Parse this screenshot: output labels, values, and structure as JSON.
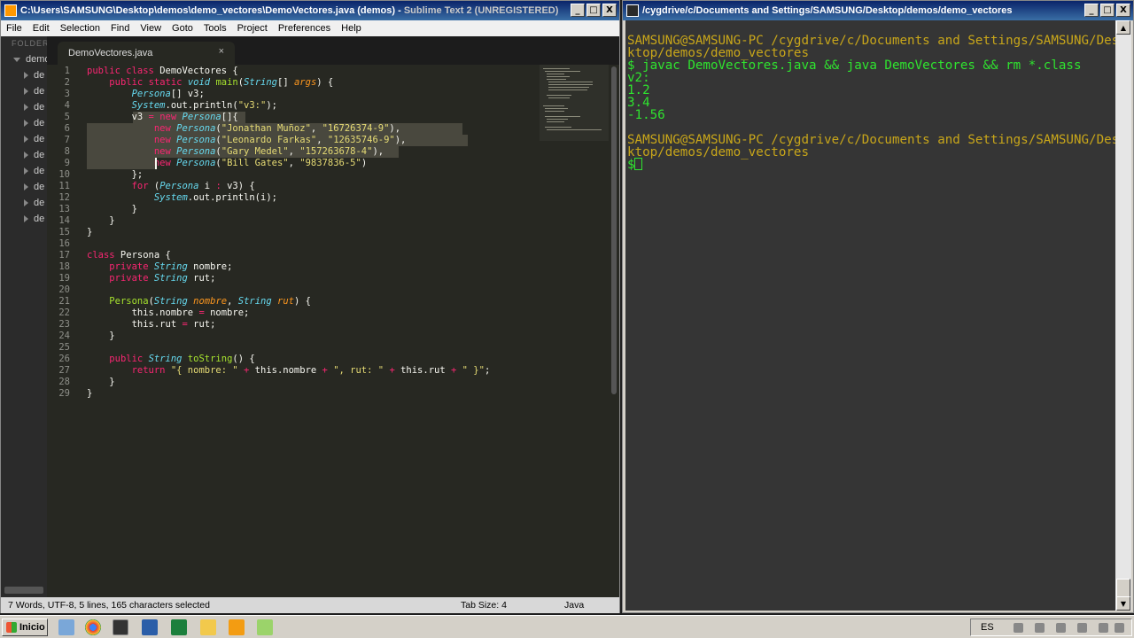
{
  "sublime": {
    "title_main": "C:\\Users\\SAMSUNG\\Desktop\\demos\\demo_vectores\\DemoVectores.java (demos) - ",
    "title_tail": "Sublime Text 2 (UNREGISTERED)",
    "window_buttons": {
      "minimize": "_",
      "maximize": "□",
      "close": "X"
    },
    "menu": [
      "File",
      "Edit",
      "Selection",
      "Find",
      "View",
      "Goto",
      "Tools",
      "Project",
      "Preferences",
      "Help"
    ],
    "sidebar": {
      "folders_label": "FOLDERS",
      "root": "demo",
      "items": [
        "de",
        "de",
        "de",
        "de",
        "de",
        "de",
        "de",
        "de",
        "de",
        "de"
      ]
    },
    "tab": {
      "label": "DemoVectores.java",
      "close": "×"
    },
    "line_numbers": [
      "1",
      "2",
      "3",
      "4",
      "5",
      "6",
      "7",
      "8",
      "9",
      "10",
      "11",
      "12",
      "13",
      "14",
      "15",
      "16",
      "17",
      "18",
      "19",
      "20",
      "21",
      "22",
      "23",
      "24",
      "25",
      "26",
      "27",
      "28",
      "29"
    ],
    "code": {
      "l1": {
        "a": "public",
        "b": " ",
        "c": "class",
        "d": " DemoVectores {"
      },
      "l2": {
        "a": "    ",
        "b": "public",
        "c": " ",
        "d": "static",
        "e": " ",
        "f": "void",
        "g": " ",
        "h": "main",
        "i": "(",
        "j": "String",
        "k": "[] ",
        "l": "args",
        "m": ") {"
      },
      "l3": {
        "a": "        ",
        "b": "Persona",
        "c": "[] v3;"
      },
      "l4": {
        "a": "        ",
        "b": "System",
        "c": ".out.",
        "d": "println",
        "e": "(",
        "f": "\"v3:\"",
        "g": ");"
      },
      "l5": {
        "a": "        v3 ",
        "b": "=",
        "c": " ",
        "d": "new",
        "e": " ",
        "f": "Persona",
        "g": "[]{"
      },
      "l6": {
        "a": "            ",
        "b": "new",
        "c": " ",
        "d": "Persona",
        "e": "(",
        "f": "\"Jonathan Muñoz\"",
        "g": ", ",
        "h": "\"16726374-9\"",
        "i": "),"
      },
      "l7": {
        "a": "            ",
        "b": "new",
        "c": " ",
        "d": "Persona",
        "e": "(",
        "f": "\"Leonardo Farkas\"",
        "g": ", ",
        "h": "\"12635746-9\"",
        "i": "),"
      },
      "l8": {
        "a": "            ",
        "b": "new",
        "c": " ",
        "d": "Persona",
        "e": "(",
        "f": "\"Gary Medel\"",
        "g": ", ",
        "h": "\"157263678-4\"",
        "i": "),"
      },
      "l9": {
        "a": "            ",
        "b": "new",
        "c": " ",
        "d": "Persona",
        "e": "(",
        "f": "\"Bill Gates\"",
        "g": ", ",
        "h": "\"9837836-5\"",
        "i": ")"
      },
      "l10": {
        "a": "        };"
      },
      "l11": {
        "a": "        ",
        "b": "for",
        "c": " (",
        "d": "Persona",
        "e": " i ",
        "f": ":",
        "g": " v3) {"
      },
      "l12": {
        "a": "            ",
        "b": "System",
        "c": ".out.",
        "d": "println",
        "e": "(i);"
      },
      "l13": {
        "a": "        }"
      },
      "l14": {
        "a": "    }"
      },
      "l15": {
        "a": "}"
      },
      "l16": {
        "a": ""
      },
      "l17": {
        "a": "class",
        "b": " Persona {"
      },
      "l18": {
        "a": "    ",
        "b": "private",
        "c": " ",
        "d": "String",
        "e": " nombre;"
      },
      "l19": {
        "a": "    ",
        "b": "private",
        "c": " ",
        "d": "String",
        "e": " rut;"
      },
      "l20": {
        "a": ""
      },
      "l21": {
        "a": "    ",
        "b": "Persona",
        "c": "(",
        "d": "String",
        "e": " ",
        "f": "nombre",
        "g": ", ",
        "h": "String",
        "i": " ",
        "j": "rut",
        "k": ") {"
      },
      "l22": {
        "a": "        this.nombre ",
        "b": "=",
        "c": " nombre;"
      },
      "l23": {
        "a": "        this.rut ",
        "b": "=",
        "c": " rut;"
      },
      "l24": {
        "a": "    }"
      },
      "l25": {
        "a": ""
      },
      "l26": {
        "a": "    ",
        "b": "public",
        "c": " ",
        "d": "String",
        "e": " ",
        "f": "toString",
        "g": "() {"
      },
      "l27": {
        "a": "        ",
        "b": "return",
        "c": " ",
        "d": "\"{ nombre: \"",
        "e": " ",
        "f": "+",
        "g": " this.nombre ",
        "h": "+",
        "i": " ",
        "j": "\", rut: \"",
        "k": " ",
        "l": "+",
        "m": " this.rut ",
        "n": "+",
        "o": " ",
        "p": "\" }\"",
        "q": ";"
      },
      "l28": {
        "a": "    }"
      },
      "l29": {
        "a": "}"
      }
    },
    "status": {
      "left": "7 Words, UTF-8, 5 lines, 165 characters selected",
      "tab_size": "Tab Size: 4",
      "syntax": "Java"
    },
    "colors": {
      "background": "#272822",
      "keyword": "#f92672",
      "type": "#66d9ef",
      "string": "#e6db74",
      "function": "#a6e22e",
      "argument": "#fd971f",
      "selection": "#49483e"
    }
  },
  "terminal": {
    "title": "/cygdrive/c/Documents and Settings/SAMSUNG/Desktop/demos/demo_vectores",
    "window_buttons": {
      "minimize": "_",
      "maximize": "□",
      "close": "X"
    },
    "lines": [
      {
        "text": "SAMSUNG@SAMSUNG-PC /cygdrive/c/Documents and Settings/SAMSUNG/Des",
        "color": "yellow"
      },
      {
        "text": "ktop/demos/demo_vectores",
        "color": "yellow"
      },
      {
        "text": "$ javac DemoVectores.java && java DemoVectores && rm *.class",
        "color": "green"
      },
      {
        "text": "v2:",
        "color": "green"
      },
      {
        "text": "1.2",
        "color": "green"
      },
      {
        "text": "3.4",
        "color": "green"
      },
      {
        "text": "-1.56",
        "color": "green"
      },
      {
        "text": "",
        "color": "green"
      },
      {
        "text": "SAMSUNG@SAMSUNG-PC /cygdrive/c/Documents and Settings/SAMSUNG/Des",
        "color": "yellow"
      },
      {
        "text": "ktop/demos/demo_vectores",
        "color": "yellow"
      },
      {
        "text": "$ ",
        "color": "green"
      }
    ],
    "scroll_buttons": {
      "up": "▲",
      "down": "▼"
    },
    "colors": {
      "background": "#353535",
      "prompt": "#c8a61a",
      "text": "#2fe32f"
    }
  },
  "taskbar": {
    "start_label": "Inicio",
    "language": "ES",
    "apps": [
      "explorer-icon",
      "chrome-icon",
      "terminal-icon",
      "virtualbox-icon",
      "cygwin-icon",
      "folder-icon",
      "sublime-icon",
      "notepad-icon"
    ]
  }
}
